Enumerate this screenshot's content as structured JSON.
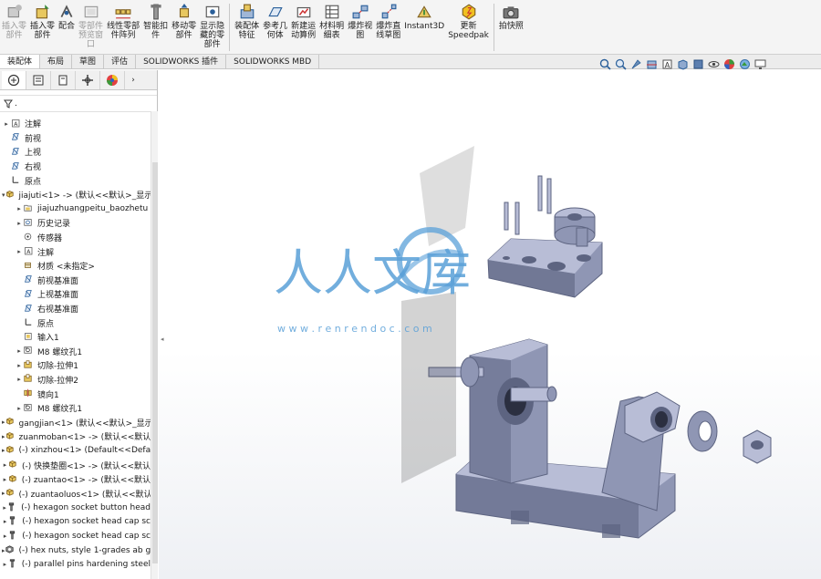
{
  "ribbon": {
    "buttons": [
      {
        "label": "插入零\n部件",
        "icon": "insert-component-icon",
        "disabled": true
      },
      {
        "label": "插入零\n部件",
        "icon": "insert-part-icon",
        "disabled": false
      },
      {
        "label": "配合",
        "icon": "mate-icon",
        "disabled": false
      },
      {
        "label": "零部件\n预览窗\n口",
        "icon": "component-preview-icon",
        "disabled": true
      },
      {
        "label": "线性零部\n件阵列",
        "icon": "linear-pattern-icon",
        "disabled": false
      },
      {
        "label": "智能扣\n件",
        "icon": "smart-fasteners-icon",
        "disabled": false
      },
      {
        "label": "移动零\n部件",
        "icon": "move-component-icon",
        "disabled": false
      },
      {
        "label": "显示隐\n藏的零\n部件",
        "icon": "show-hidden-icon",
        "disabled": false
      },
      {
        "label": "装配体\n特征",
        "icon": "assembly-feature-icon",
        "disabled": false
      },
      {
        "label": "参考几\n何体",
        "icon": "reference-geometry-icon",
        "disabled": false
      },
      {
        "label": "新建运\n动算例",
        "icon": "motion-study-icon",
        "disabled": false
      },
      {
        "label": "材料明\n细表",
        "icon": "bom-icon",
        "disabled": false
      },
      {
        "label": "爆炸视\n图",
        "icon": "exploded-view-icon",
        "disabled": false
      },
      {
        "label": "爆炸直\n线草图",
        "icon": "explode-line-icon",
        "disabled": false
      },
      {
        "label": "Instant3D",
        "icon": "instant3d-icon",
        "disabled": false
      },
      {
        "label": "更新\nSpeedpak",
        "icon": "speedpak-icon",
        "disabled": false
      },
      {
        "label": "拍快照",
        "icon": "snapshot-icon",
        "disabled": false
      }
    ]
  },
  "command_tabs": [
    {
      "label": "装配体",
      "active": true
    },
    {
      "label": "布局",
      "active": false
    },
    {
      "label": "草图",
      "active": false
    },
    {
      "label": "评估",
      "active": false
    },
    {
      "label": "SOLIDWORKS 插件",
      "active": false
    },
    {
      "label": "SOLIDWORKS MBD",
      "active": false
    }
  ],
  "panel": {
    "filter_text": "."
  },
  "tree": [
    {
      "indent": 0,
      "arrow": "▸",
      "icon": "annotations-icon",
      "label": "注解"
    },
    {
      "indent": 0,
      "arrow": "",
      "icon": "plane-icon",
      "label": "前视"
    },
    {
      "indent": 0,
      "arrow": "",
      "icon": "plane-icon",
      "label": "上视"
    },
    {
      "indent": 0,
      "arrow": "",
      "icon": "plane-icon",
      "label": "右视"
    },
    {
      "indent": 0,
      "arrow": "",
      "icon": "origin-icon",
      "label": "原点"
    },
    {
      "indent": 0,
      "arrow": "▾",
      "icon": "part-icon",
      "label": "jiajuti<1> -> (默认<<默认>_显示"
    },
    {
      "indent": 1,
      "arrow": "▸",
      "icon": "folder-icon",
      "label": "jiajuzhuangpeitu_baozhetu"
    },
    {
      "indent": 1,
      "arrow": "▸",
      "icon": "history-icon",
      "label": "历史记录"
    },
    {
      "indent": 1,
      "arrow": "",
      "icon": "sensor-icon",
      "label": "传感器"
    },
    {
      "indent": 1,
      "arrow": "▸",
      "icon": "annotations-icon",
      "label": "注解"
    },
    {
      "indent": 1,
      "arrow": "",
      "icon": "material-icon",
      "label": "材质 <未指定>"
    },
    {
      "indent": 1,
      "arrow": "",
      "icon": "plane-icon",
      "label": "前视基准面"
    },
    {
      "indent": 1,
      "arrow": "",
      "icon": "plane-icon",
      "label": "上视基准面"
    },
    {
      "indent": 1,
      "arrow": "",
      "icon": "plane-icon",
      "label": "右视基准面"
    },
    {
      "indent": 1,
      "arrow": "",
      "icon": "origin-icon",
      "label": "原点"
    },
    {
      "indent": 1,
      "arrow": "",
      "icon": "import-icon",
      "label": "输入1"
    },
    {
      "indent": 1,
      "arrow": "▸",
      "icon": "hole-icon",
      "label": "M8 螺纹孔1"
    },
    {
      "indent": 1,
      "arrow": "▸",
      "icon": "cut-extrude-icon",
      "label": "切除-拉伸1"
    },
    {
      "indent": 1,
      "arrow": "▸",
      "icon": "cut-extrude-icon",
      "label": "切除-拉伸2"
    },
    {
      "indent": 1,
      "arrow": "",
      "icon": "mirror-icon",
      "label": "镜向1"
    },
    {
      "indent": 1,
      "arrow": "▸",
      "icon": "hole-icon",
      "label": "M8 螺纹孔1"
    },
    {
      "indent": 0,
      "arrow": "▸",
      "icon": "part-icon",
      "label": "gangjian<1> (默认<<默认>_显示"
    },
    {
      "indent": 0,
      "arrow": "▸",
      "icon": "part-icon",
      "label": "zuanmoban<1> -> (默认<<默认"
    },
    {
      "indent": 0,
      "arrow": "▸",
      "icon": "part-icon",
      "label": "(-) xinzhou<1> (Default<<Defa"
    },
    {
      "indent": 0,
      "arrow": "▸",
      "icon": "part-icon",
      "label": "(-) 快换垫圈<1> -> (默认<<默认"
    },
    {
      "indent": 0,
      "arrow": "▸",
      "icon": "part-icon",
      "label": "(-) zuantao<1> -> (默认<<默认"
    },
    {
      "indent": 0,
      "arrow": "▸",
      "icon": "part-icon",
      "label": "(-) zuantaoluos<1> (默认<<默认"
    },
    {
      "indent": 0,
      "arrow": "▸",
      "icon": "screw-icon",
      "label": "(-) hexagon socket button head"
    },
    {
      "indent": 0,
      "arrow": "▸",
      "icon": "screw-icon",
      "label": "(-) hexagon socket head cap sc"
    },
    {
      "indent": 0,
      "arrow": "▸",
      "icon": "screw-icon",
      "label": "(-) hexagon socket head cap sc"
    },
    {
      "indent": 0,
      "arrow": "▸",
      "icon": "nut-icon",
      "label": "(-) hex nuts, style 1-grades ab g"
    },
    {
      "indent": 0,
      "arrow": "▸",
      "icon": "pin-icon",
      "label": "(-) parallel pins hardening steel"
    }
  ],
  "watermark": {
    "title": "人人文库",
    "url": "w w w . r e n r e n d o c . c o m"
  },
  "colors": {
    "part": "#8f96b4",
    "part_dark": "#5d6481",
    "part_light": "#b8bdd6",
    "watermark": "#5aa0d8"
  }
}
